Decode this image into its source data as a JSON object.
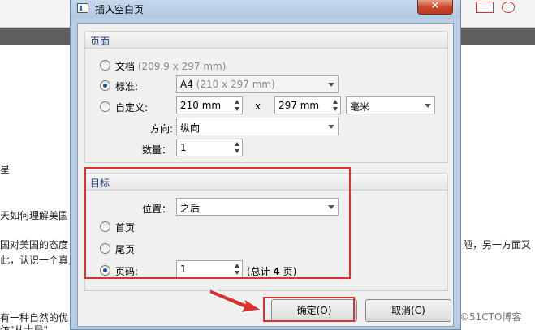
{
  "background": {
    "lines": [
      {
        "text": "星"
      },
      {
        "text": "天如何理解美国"
      },
      {
        "text": "国对美国的态度"
      },
      {
        "text": "此，认识一个真"
      },
      {
        "text": "有一种自然的优"
      },
      {
        "text": "陋，另一方面又"
      },
      {
        "text": "仿\"从士局\""
      }
    ]
  },
  "dialog": {
    "title": "插入空白页",
    "close_label": "✕",
    "page_group": {
      "title": "页面",
      "document_label": "文档",
      "document_size": "(209.9 x 297 mm)",
      "standard_label": "标准:",
      "standard_value": "A4",
      "standard_size": "(210 x 297 mm)",
      "custom_label": "自定义:",
      "width_value": "210 mm",
      "times": "x",
      "height_value": "297 mm",
      "unit_value": "毫米",
      "orientation_label": "方向:",
      "orientation_value": "纵向",
      "count_label": "数量：",
      "count_value": "1"
    },
    "target_group": {
      "title": "目标",
      "position_label": "位置：",
      "position_value": "之后",
      "first_page_label": "首页",
      "last_page_label": "尾页",
      "page_number_label": "页码:",
      "page_number_value": "1",
      "total_prefix": "(总计 ",
      "total_count": "4",
      "total_suffix": " 页)"
    },
    "ok_label": "确定(O)",
    "cancel_label": "取消(C)"
  },
  "watermark": "©51CTO博客",
  "colors": {
    "annotation_red": "#e0302e",
    "dialog_frame": "#b9cde4",
    "group_title": "#1e3a78"
  }
}
